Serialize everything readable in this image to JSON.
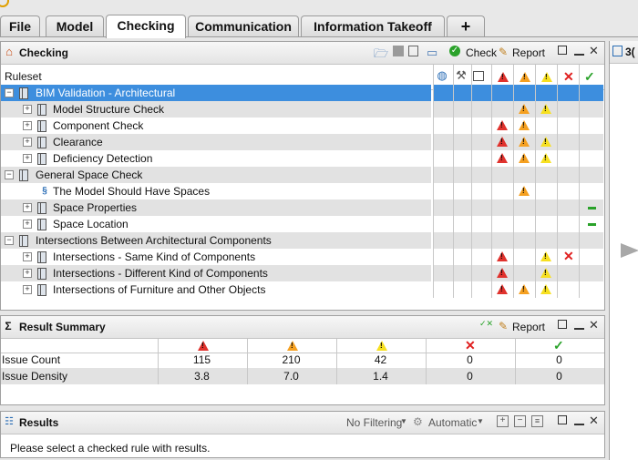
{
  "tabs": [
    {
      "label": "File",
      "active": false
    },
    {
      "label": "Model",
      "active": false
    },
    {
      "label": "Checking",
      "active": true
    },
    {
      "label": "Communication",
      "active": false
    },
    {
      "label": "Information Takeoff",
      "active": false
    },
    {
      "label": "+",
      "active": false
    }
  ],
  "checking_panel": {
    "title": "Checking",
    "check_label": "Check",
    "report_label": "Report",
    "ruleset_header": "Ruleset",
    "rows": [
      {
        "label": "BIM Validation - Architectural",
        "level": 0,
        "selected": true,
        "marks": [
          "",
          "",
          "",
          "",
          "",
          "",
          ""
        ]
      },
      {
        "label": "Model Structure Check",
        "level": 1,
        "marks": [
          "",
          "",
          "",
          "",
          "orange",
          "yellow",
          ""
        ]
      },
      {
        "label": "Component Check",
        "level": 1,
        "marks": [
          "",
          "",
          "",
          "red",
          "orange",
          "",
          ""
        ]
      },
      {
        "label": "Clearance",
        "level": 1,
        "marks": [
          "",
          "",
          "",
          "red",
          "orange",
          "yellow",
          ""
        ]
      },
      {
        "label": "Deficiency Detection",
        "level": 1,
        "marks": [
          "",
          "",
          "",
          "red",
          "orange",
          "yellow",
          ""
        ]
      },
      {
        "label": "General Space Check",
        "level": 0,
        "marks": [
          "",
          "",
          "",
          "",
          "",
          "",
          ""
        ]
      },
      {
        "label": "The Model Should Have Spaces",
        "level": 1,
        "rule": true,
        "marks": [
          "",
          "",
          "",
          "",
          "orange",
          "",
          ""
        ]
      },
      {
        "label": "Space Properties",
        "level": 1,
        "marks": [
          "",
          "",
          "",
          "",
          "",
          "",
          "dash"
        ]
      },
      {
        "label": "Space Location",
        "level": 1,
        "marks": [
          "",
          "",
          "",
          "",
          "",
          "",
          "dash"
        ]
      },
      {
        "label": "Intersections Between Architectural Components",
        "level": 0,
        "marks": [
          "",
          "",
          "",
          "",
          "",
          "",
          ""
        ]
      },
      {
        "label": "Intersections - Same Kind of Components",
        "level": 1,
        "marks": [
          "",
          "",
          "",
          "red",
          "",
          "yellow",
          "x"
        ]
      },
      {
        "label": "Intersections - Different Kind of Components",
        "level": 1,
        "marks": [
          "",
          "",
          "",
          "red",
          "",
          "yellow",
          ""
        ]
      },
      {
        "label": "Intersections of Furniture and Other Objects",
        "level": 1,
        "marks": [
          "",
          "",
          "",
          "red",
          "orange",
          "yellow",
          ""
        ]
      }
    ]
  },
  "result_summary": {
    "title": "Result Summary",
    "report_label": "Report",
    "rows": [
      {
        "label": "Issue Count",
        "values": [
          "115",
          "210",
          "42",
          "0",
          "0"
        ]
      },
      {
        "label": "Issue Density",
        "values": [
          "3.8",
          "7.0",
          "1.4",
          "0",
          "0"
        ]
      }
    ]
  },
  "results": {
    "title": "Results",
    "filter_label": "No Filtering",
    "auto_label": "Automatic",
    "message": "Please select a checked rule with results."
  },
  "right_panel": {
    "label": "3("
  },
  "colors": {
    "selection": "#3d8ede",
    "red": "#e0322d",
    "orange": "#f5a020",
    "yellow": "#f7e020",
    "green": "#2aa22a"
  }
}
